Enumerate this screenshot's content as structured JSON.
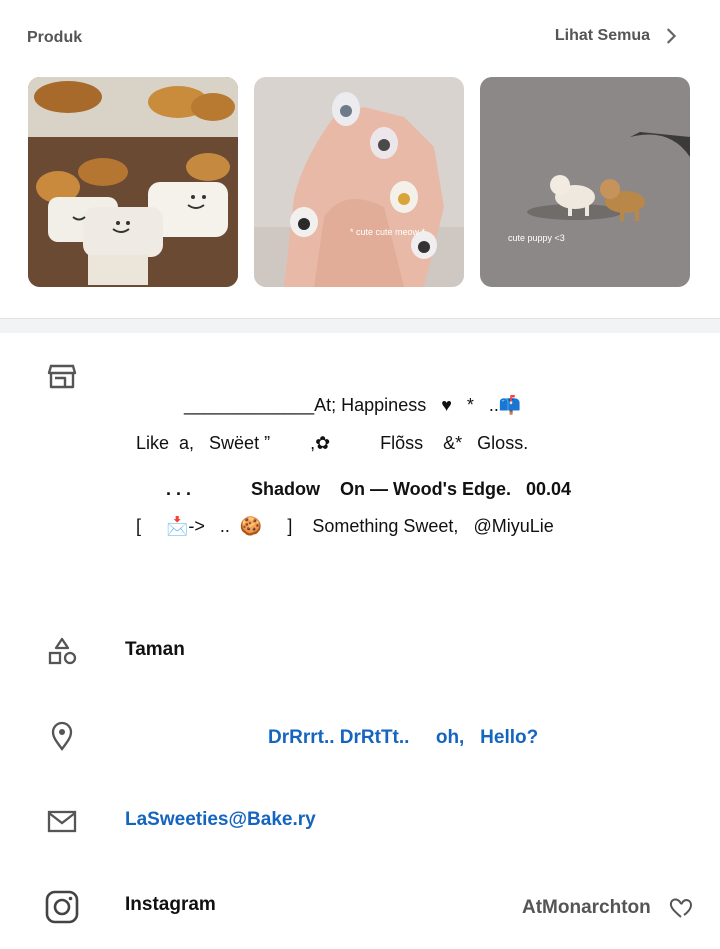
{
  "header": {
    "title": "Produk",
    "see_all": "Lihat Semua"
  },
  "products": [
    {
      "name": "bakery",
      "caption": ""
    },
    {
      "name": "nails",
      "caption": "* cute cute meow *"
    },
    {
      "name": "puppies",
      "caption": "cute puppy <3"
    }
  ],
  "description": {
    "line1": "_____________At; Happiness   ♥   *   ..📫",
    "line2": "Like  a,   Swëet ”        ,✿          Flõss    &*   Gloss.",
    "line3": ". . .            Shadow    On — Wood's Edge.   00.04",
    "line4": "[     📩->   ..  🍪     ]    Something Sweet,   @MiyuLie"
  },
  "rows": {
    "category": "Taman",
    "location": "DrRrrt.. DrRtTt..     oh,   Hello?",
    "email": "LaSweeties@Bake.ry",
    "instagram_label": "Instagram",
    "instagram_handle": "AtMonarchton"
  },
  "colors": {
    "link": "#1565c0",
    "icon": "#555555",
    "divider": "#f1f3f4"
  },
  "icons": [
    "store-icon",
    "shapes-icon",
    "location-pin-icon",
    "mail-icon",
    "instagram-icon",
    "chevron-right-icon",
    "heart-outline-icon"
  ]
}
